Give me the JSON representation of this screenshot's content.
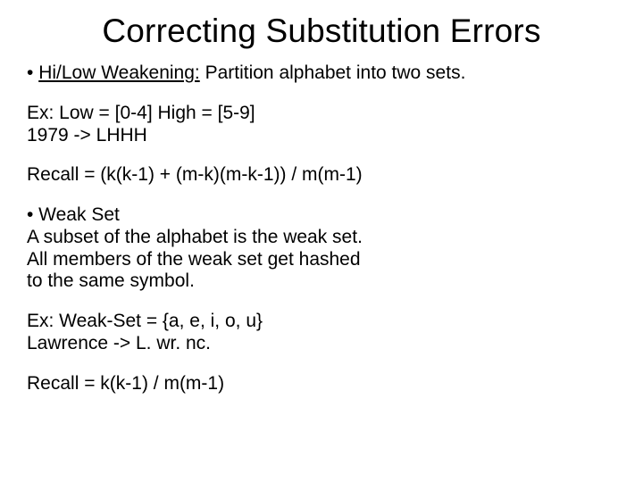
{
  "title": "Correcting Substitution Errors",
  "bullet1_prefix": "• ",
  "bullet1_head": "Hi/Low Weakening:",
  "bullet1_rest": " Partition alphabet into two sets.",
  "ex1_line1": "Ex: Low = [0-4]  High = [5-9]",
  "ex1_line2": "1979 -> LHHH",
  "recall1": "Recall = (k(k-1) + (m-k)(m-k-1)) /  m(m-1)",
  "bullet2": "• Weak Set",
  "weak_line1": "A subset of the alphabet is the weak set.",
  "weak_line2": "All members of the weak set get hashed",
  "weak_line3": "to the same symbol.",
  "ex2_line1": "Ex: Weak-Set = {a, e, i, o, u}",
  "ex2_line2": "Lawrence -> L. wr. nc.",
  "recall2": "Recall = k(k-1) / m(m-1)"
}
